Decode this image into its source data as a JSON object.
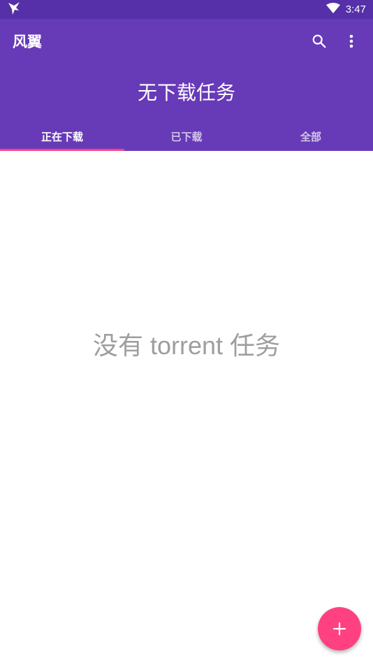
{
  "status_bar": {
    "time": "3:47",
    "icons": [
      "app-notification-icon",
      "wifi-icon",
      "battery-icon"
    ]
  },
  "toolbar": {
    "title": "风翼",
    "actions": [
      "search-icon",
      "more-vert-icon"
    ]
  },
  "header": {
    "text": "无下载任务"
  },
  "tabs": [
    {
      "label": "正在下载",
      "active": true
    },
    {
      "label": "已下载",
      "active": false
    },
    {
      "label": "全部",
      "active": false
    }
  ],
  "main": {
    "empty_message": "没有 torrent 任务"
  },
  "fab": {
    "icon": "add-icon"
  },
  "colors": {
    "primary": "#673ab7",
    "primary_dark": "#5530a8",
    "accent": "#ff4081",
    "empty_text": "#9e9e9e"
  }
}
